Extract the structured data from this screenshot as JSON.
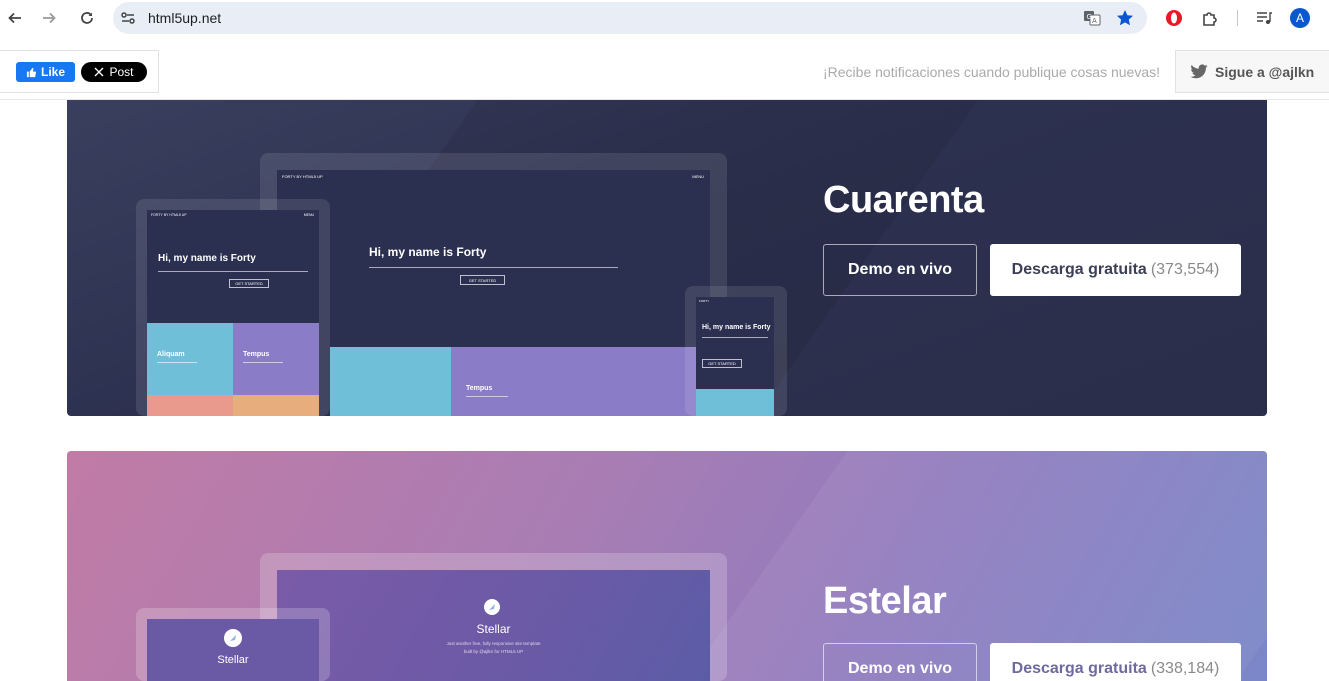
{
  "browser": {
    "url": "html5up.net",
    "profile_initial": "A",
    "icons": [
      "back-icon",
      "forward-icon",
      "reload-icon",
      "site-info-icon",
      "translate-icon",
      "bookmark-star-icon",
      "opera-icon",
      "extensions-icon",
      "media-control-icon"
    ],
    "accent": "#0b57d0"
  },
  "social": {
    "like_label": "Like",
    "post_label": "Post",
    "notify_text": "¡Recibe notificaciones cuando publique cosas nuevas!",
    "follow_label": "Sigue a @ajlkn",
    "fb_color": "#1877f2"
  },
  "cards": [
    {
      "title": "Cuarenta",
      "demo_label": "Demo en vivo",
      "download_label": "Descarga gratuita",
      "download_count": "(373,554)",
      "mockup": {
        "heading": "Hi, my name is Forty",
        "nav_right": "MENU",
        "logo": "FORTY",
        "by": "BY HTML5 UP",
        "button": "GET STARTED",
        "tiles": [
          "Aliquam",
          "Tempus"
        ]
      }
    },
    {
      "title": "Estelar",
      "demo_label": "Demo en vivo",
      "download_label": "Descarga gratuita",
      "download_count": "(338,184)",
      "mockup": {
        "heading": "Stellar",
        "subtext": "Just another free, fully responsive site template",
        "subtext2": "built by @ajlkn for HTML5 UP"
      }
    }
  ]
}
